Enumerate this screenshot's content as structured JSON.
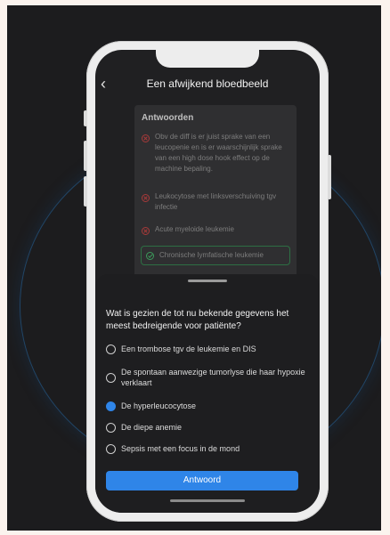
{
  "header": {
    "back_icon": "chevron-left-icon",
    "title": "Een afwijkend bloedbeeld"
  },
  "answers_panel": {
    "title": "Antwoorden",
    "items": [
      {
        "text": "Obv de diff  is er juist sprake van een leucopenie en is er waarschijnlijk sprake van een high dose hook effect op de machine bepaling.",
        "status": "incorrect"
      },
      {
        "text": "Leukocytose met linksverschuiving tgv infectie",
        "status": "incorrect"
      },
      {
        "text": "Acute myeloide leukemie",
        "status": "incorrect"
      },
      {
        "text": "Chronische lymfatische leukemie",
        "status": "correct"
      }
    ]
  },
  "question": {
    "text": "Wat is gezien de tot nu bekende gegevens het meest bedreigende voor patiënte?",
    "options": [
      {
        "label": "Een trombose tgv de leukemie en DIS",
        "selected": false
      },
      {
        "label": "De spontaan aanwezige tumorlyse die haar hypoxie verklaart",
        "selected": false
      },
      {
        "label": "De hyperleucocytose",
        "selected": true
      },
      {
        "label": "De diepe anemie",
        "selected": false
      },
      {
        "label": "Sepsis met een focus in de mond",
        "selected": false
      }
    ],
    "submit_label": "Antwoord"
  },
  "colors": {
    "accent": "#2f85e8",
    "correct": "#3c9a5b",
    "incorrect": "#a73a3a"
  }
}
